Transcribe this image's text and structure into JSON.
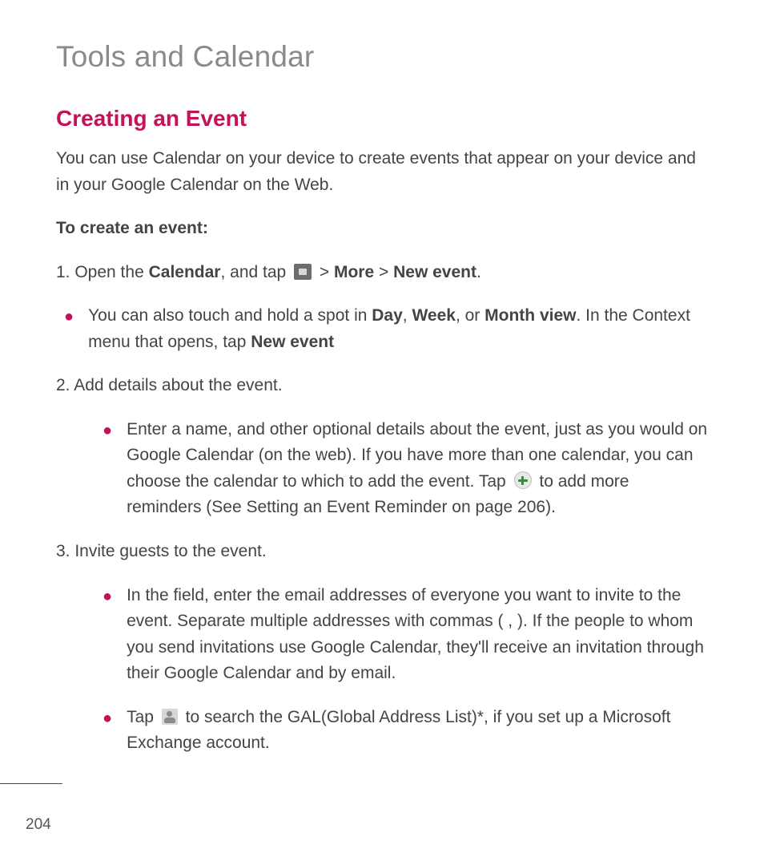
{
  "chapter_title": "Tools and Calendar",
  "section_title": "Creating an Event",
  "intro_para": "You can use Calendar on your device to create events that appear on your device and in your Google Calendar on the Web.",
  "subhead": "To create an event:",
  "step1": {
    "prefix": "1. Open the ",
    "b1": "Calendar",
    "mid1": ", and tap ",
    "gt1": " > ",
    "b2": "More",
    "gt2": " > ",
    "b3": "New event",
    "suffix": "."
  },
  "bullet1": {
    "t1": "You can also touch and hold a spot in ",
    "b1": "Day",
    "t2": ", ",
    "b2": "Week",
    "t3": ", or ",
    "b3": "Month view",
    "t4": ". In the Context menu that opens, tap ",
    "b4": "New event"
  },
  "step2": "2. Add details about the event.",
  "bullet2": {
    "t1": "Enter a name, and other optional details about the event, just as you would on Google Calendar (on the web). If you have more than one calendar, you can choose the calendar to which to add the event. Tap ",
    "t2": " to add more reminders (See Setting an Event Reminder on page 206)."
  },
  "step3": "3. Invite guests to the event.",
  "bullet3": "In the field, enter the email addresses of everyone you want to invite to the event. Separate multiple addresses with commas ( , ). If the people to whom you send invitations use Google Calendar, they'll receive an invitation through their Google Calendar and by email.",
  "bullet4": {
    "t1": "Tap ",
    "t2": " to search the GAL(Global Address List)*, if you set up a Microsoft Exchange account."
  },
  "page_number": "204"
}
